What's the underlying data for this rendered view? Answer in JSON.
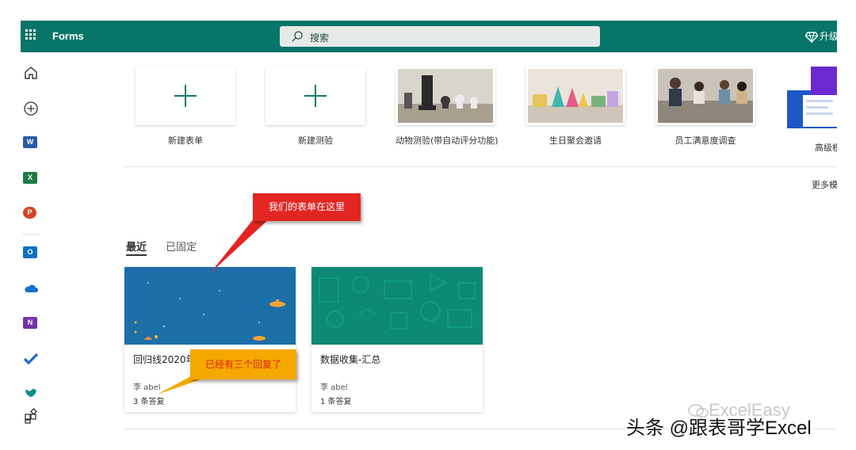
{
  "app": {
    "title": "Forms"
  },
  "search": {
    "placeholder": "搜索"
  },
  "header": {
    "upgrade_label": "升级"
  },
  "rail": {
    "items": [
      "home-icon",
      "create-icon",
      "word-icon",
      "excel-icon",
      "powerpoint-icon",
      "outlook-icon",
      "onedrive-icon",
      "onenote-icon",
      "todo-icon",
      "viva-icon",
      "all-apps-icon"
    ]
  },
  "templates": [
    {
      "label": "新建表单"
    },
    {
      "label": "新建测验"
    },
    {
      "label": "动物测验(带自动评分功能)"
    },
    {
      "label": "生日聚会邀请"
    },
    {
      "label": "员工满意度调查"
    },
    {
      "label": "高级模"
    }
  ],
  "more_templates": "更多模",
  "tabs": [
    {
      "label": "最近"
    },
    {
      "label": "已固定"
    }
  ],
  "forms": [
    {
      "title": "回归线2020年",
      "owner": "李 abel",
      "responses": "3 条答复"
    },
    {
      "title": "数据收集-汇总",
      "owner": "李 abel",
      "responses": "1 条答复"
    }
  ],
  "annotations": {
    "red": "我们的表单在这里",
    "yellow": "已经有三个回复了"
  },
  "watermarks": {
    "wechat": "ExcelEasy",
    "toutiao": "头条 @跟表哥学Excel"
  },
  "colors": {
    "topbar": "#077568",
    "accent": "#0e7a6f",
    "red_callout": "#e32622",
    "yellow_callout": "#f5a800"
  }
}
